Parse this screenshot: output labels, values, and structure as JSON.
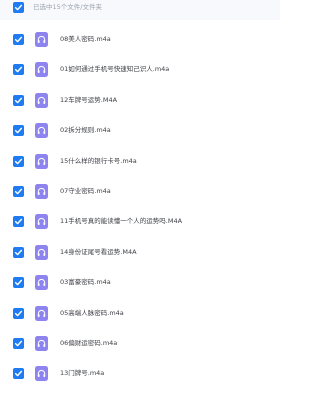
{
  "header": {
    "selection_text": "已选中15个文件/文件夹",
    "select_all_checked": true
  },
  "files": [
    {
      "name": "08美人密码.m4a",
      "checked": true,
      "icon": "audio-file-icon"
    },
    {
      "name": "01如何通过手机号快速知己识人.m4a",
      "checked": true,
      "icon": "audio-file-icon"
    },
    {
      "name": "12车牌号运势.M4A",
      "checked": true,
      "icon": "audio-file-icon"
    },
    {
      "name": "02拆分规则.m4a",
      "checked": true,
      "icon": "audio-file-icon"
    },
    {
      "name": "15什么样的银行卡号.m4a",
      "checked": true,
      "icon": "audio-file-icon"
    },
    {
      "name": "07守业密码.m4a",
      "checked": true,
      "icon": "audio-file-icon"
    },
    {
      "name": "11手机号真的能读懂一个人的运势吗.M4A",
      "checked": true,
      "icon": "audio-file-icon"
    },
    {
      "name": "14身份证尾号看运势.M4A",
      "checked": true,
      "icon": "audio-file-icon"
    },
    {
      "name": "03富豪密码.m4a",
      "checked": true,
      "icon": "audio-file-icon"
    },
    {
      "name": "05高端人脉密码.m4a",
      "checked": true,
      "icon": "audio-file-icon"
    },
    {
      "name": "06偏财运密码.m4a",
      "checked": true,
      "icon": "audio-file-icon"
    },
    {
      "name": "13门牌号.m4a",
      "checked": true,
      "icon": "audio-file-icon"
    }
  ],
  "colors": {
    "accent": "#1e7bf2",
    "file_icon": "#8e84f0",
    "text": "#3c3f45",
    "muted_text": "#9aa1ad"
  }
}
